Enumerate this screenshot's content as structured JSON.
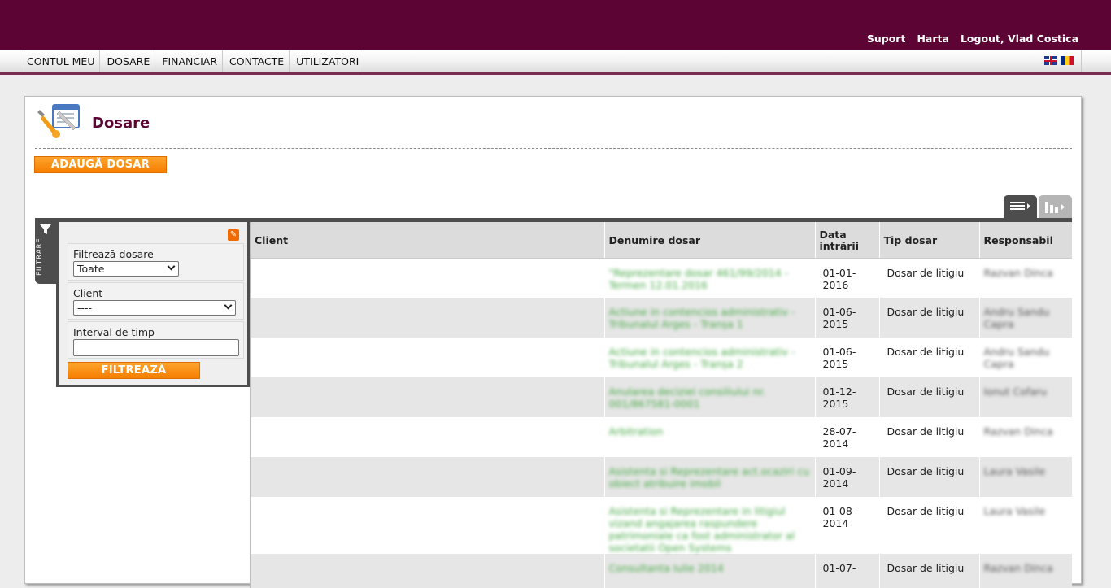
{
  "header": {
    "links": [
      "Suport",
      "Harta",
      "Logout, Vlad Costica"
    ]
  },
  "nav": {
    "items": [
      "CONTUL MEU",
      "DOSARE",
      "FINANCIAR",
      "CONTACTE",
      "UTILIZATORI"
    ]
  },
  "page": {
    "title": "Dosare",
    "add_button": "ADAUGĂ DOSAR"
  },
  "filter": {
    "tab_label": "FILTRARE",
    "dosare_label": "Filtrează dosare",
    "dosare_value": "Toate",
    "client_label": "Client",
    "client_value": "----",
    "interval_label": "Interval de timp",
    "interval_value": "",
    "button": "FILTREAZĂ"
  },
  "table": {
    "columns": [
      "Client",
      "Denumire dosar",
      "Data intrării",
      "Tip dosar",
      "Responsabil"
    ],
    "rows": [
      {
        "client": "",
        "name": "\"Reprezentare dosar 461/99/2014 - Termen 12.01.2016",
        "date": "01-01-2016",
        "type": "Dosar de litigiu",
        "resp": "Razvan Dinca"
      },
      {
        "client": "",
        "name": "Actiune in contencios administrativ - Tribunalul Arges - Tranșa 1",
        "date": "01-06-2015",
        "type": "Dosar de litigiu",
        "resp": "Andru Sandu Capra"
      },
      {
        "client": "",
        "name": "Actiune in contencios administrativ - Tribunalul Arges - Tranșa 2",
        "date": "01-06-2015",
        "type": "Dosar de litigiu",
        "resp": "Andru Sandu Capra"
      },
      {
        "client": "",
        "name": "Anularea deciziei consiliului nr. 001/867581-0001",
        "date": "01-12-2015",
        "type": "Dosar de litigiu",
        "resp": "Ionut Cofaru"
      },
      {
        "client": "",
        "name": "Arbitration",
        "date": "28-07-2014",
        "type": "Dosar de litigiu",
        "resp": "Razvan Dinca"
      },
      {
        "client": "",
        "name": "Asistenta si Reprezentare act.ocaziri cu obiect atribuire imobil",
        "date": "01-09-2014",
        "type": "Dosar de litigiu",
        "resp": "Laura Vasile"
      },
      {
        "client": "",
        "name": "Asistenta si Reprezentare in litigiul vizand angajarea raspundere patrimoniale ca fost administrator al societatii Open Systems",
        "date": "01-08-2014",
        "type": "Dosar de litigiu",
        "resp": "Laura Vasile"
      },
      {
        "client": "",
        "name": "Consultanta Iulie 2014",
        "date": "01-07-",
        "type": "Dosar de litigiu",
        "resp": "Razvan Dinca"
      }
    ]
  }
}
